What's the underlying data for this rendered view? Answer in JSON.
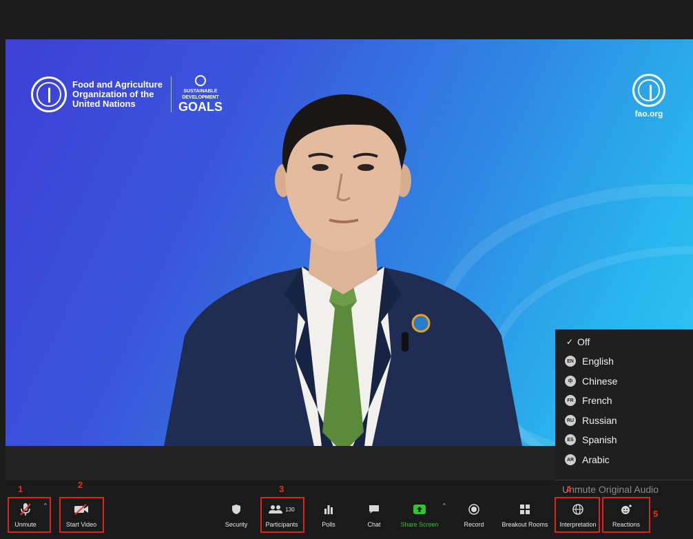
{
  "video": {
    "fao_logo_lines": [
      "Food and Agriculture",
      "Organization of the",
      "United Nations"
    ],
    "sdg_lines": [
      "SUSTAINABLE",
      "DEVELOPMENT",
      "GOALS"
    ],
    "fao_site": "fao.org"
  },
  "interpretation_menu": {
    "items": [
      {
        "label": "Off",
        "checked": true,
        "badge": ""
      },
      {
        "label": "English",
        "checked": false,
        "badge": "EN"
      },
      {
        "label": "Chinese",
        "checked": false,
        "badge": "中"
      },
      {
        "label": "French",
        "checked": false,
        "badge": "FR"
      },
      {
        "label": "Russian",
        "checked": false,
        "badge": "RU"
      },
      {
        "label": "Spanish",
        "checked": false,
        "badge": "ES"
      },
      {
        "label": "Arabic",
        "checked": false,
        "badge": "AR"
      }
    ],
    "unmute_original": "Unmute Original Audio"
  },
  "toolbar": {
    "unmute": "Unmute",
    "start_video": "Start Video",
    "security": "Security",
    "participants": "Participants",
    "participants_count": "130",
    "polls": "Polls",
    "chat": "Chat",
    "share_screen": "Share Screen",
    "record": "Record",
    "breakout_rooms": "Breakout Rooms",
    "interpretation": "Interpretation",
    "reactions": "Reactions"
  },
  "annotations": [
    "1",
    "2",
    "3",
    "4",
    "5"
  ],
  "colors": {
    "highlight": "#e0241a",
    "share_green": "#2ec52e",
    "toolbar_bg": "#1a1a1a",
    "menu_bg": "#1f1f1f"
  }
}
